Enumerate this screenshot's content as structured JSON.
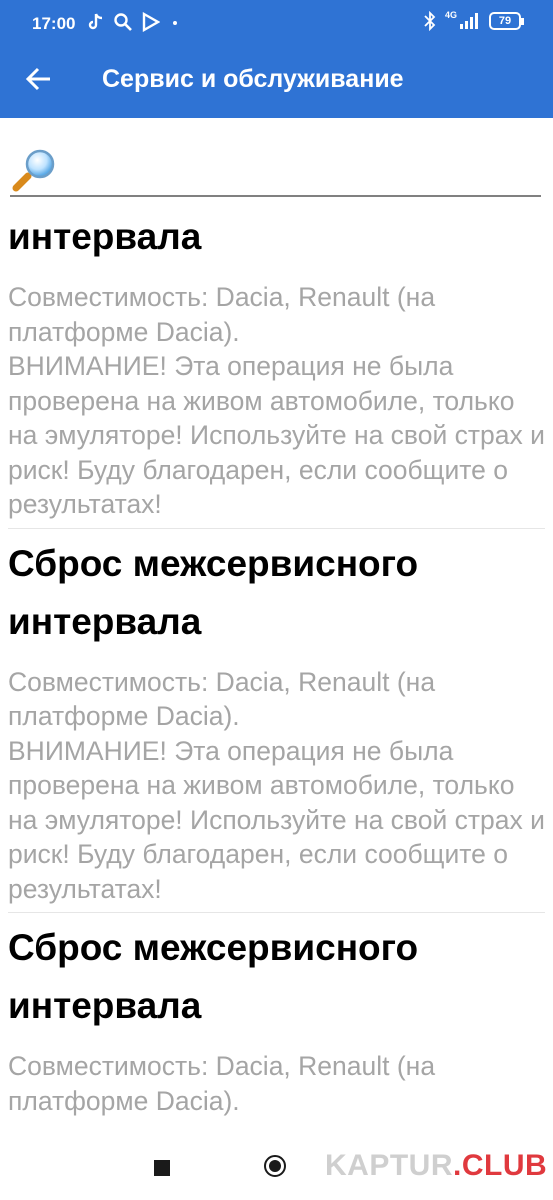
{
  "status_bar": {
    "time": "17:00",
    "network": "4G",
    "battery": "79"
  },
  "toolbar": {
    "title": "Сервис и обслуживание",
    "back_icon": "arrow-left-icon",
    "color": "#2f73d4"
  },
  "search": {
    "icon": "magnifier-icon",
    "value": ""
  },
  "items": [
    {
      "title": "интервала",
      "description": "Совместимость: Dacia, Renault (на платформе Dacia).\nВНИМАНИЕ! Эта операция не была проверена на живом автомобиле, только на эмуляторе! Используйте на свой страх и риск! Буду благодарен, если сообщите о результатах!"
    },
    {
      "title": "Сброс межсервисного интервала",
      "description": "Совместимость: Dacia, Renault (на платформе Dacia).\nВНИМАНИЕ! Эта операция не была проверена на живом автомобиле, только на эмуляторе! Используйте на свой страх и риск! Буду благодарен, если сообщите о результатах!"
    },
    {
      "title": "Сброс межсервисного интервала",
      "description": "Совместимость: Dacia, Renault (на платформе Dacia)."
    }
  ],
  "watermark": {
    "part1": "KAPTUR",
    "part2": ".CLUB"
  }
}
